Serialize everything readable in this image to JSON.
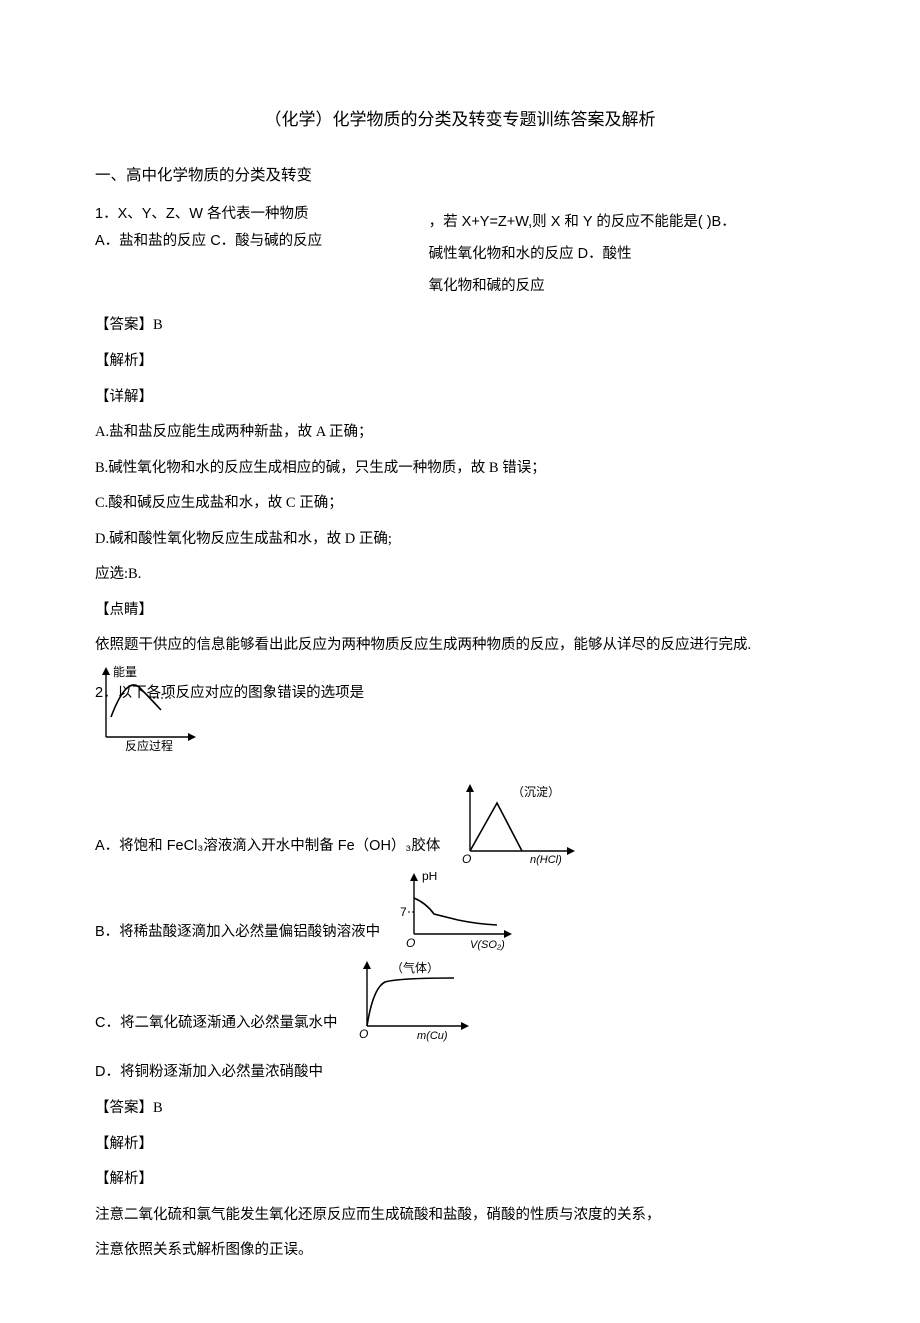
{
  "title": "（化学）化学物质的分类及转变专题训练答案及解析",
  "section": "一、高中化学物质的分类及转变",
  "q1": {
    "stem_l1": "1．X、Y、Z、W 各代表一种物质",
    "stem_l2": "A．盐和盐的反应  C．酸与碱的反应",
    "stem_r1": "，若 X+Y=Z+W,则 X 和 Y 的反应不能能是(  )B．",
    "stem_r2": "碱性氧化物和水的反应 D．酸性",
    "stem_r3": "氧化物和碱的反应",
    "ans": "【答案】B",
    "jiexi": "【解析】",
    "xiangjie": "【详解】",
    "d1": "A.盐和盐反应能生成两种新盐，故 A 正确；",
    "d2": "B.碱性氧化物和水的反应生成相应的碱，只生成一种物质，故 B 错误；",
    "d3": "C.酸和碱反应生成盐和水，故 C 正确；",
    "d4": "D.碱和酸性氧化物反应生成盐和水，故 D 正确;",
    "d5": "应选:B.",
    "dianjing": "【点睛】",
    "d6": "依照题干供应的信息能够看出此反应为两种物质反应生成两种物质的反应，能够从详尽的反应进行完成."
  },
  "q2": {
    "head": "2．以下各项反应对应的图象错误的选项是",
    "axis1_x": "反应过程",
    "axis1_y": "能量",
    "optA": "A．将饱和 FeCl₃溶液滴入开水中制备 Fe（OH）₃胶体",
    "axisA_note": "（沉淀）",
    "axisA_x": "n(HCl)",
    "optB": "B．将稀盐酸逐滴加入必然量偏铝酸钠溶液中",
    "axisB_y": "pH",
    "axisB_tick": "7",
    "axisB_x": "V(SO₂)",
    "optC": "C．将二氧化硫逐渐通入必然量氯水中",
    "axisC_note": "（气体）",
    "axisC_x": "m(Cu)",
    "optD": "D．将铜粉逐渐加入必然量浓硝酸中",
    "ans": "【答案】B",
    "jiexi1": "【解析】",
    "jiexi2": "【解析】",
    "p1": "注意二氧化硫和氯气能发生氧化还原反应而生成硫酸和盐酸，硝酸的性质与浓度的关系，",
    "p2": "注意依照关系式解析图像的正误。"
  }
}
